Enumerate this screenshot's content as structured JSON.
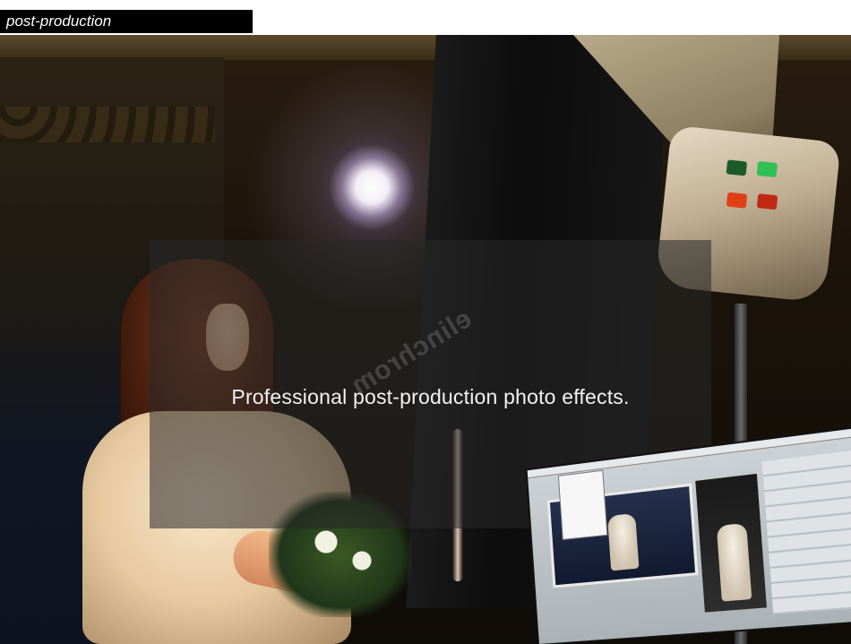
{
  "header": {
    "section_title": "post-production"
  },
  "hero": {
    "caption": "Professional post-production photo effects.",
    "softbox_brand": "elinchrom"
  },
  "colors": {
    "title_bar_bg": "#000000",
    "title_bar_text": "#ffffff",
    "overlay_bg": "rgba(40,40,40,0.55)",
    "caption_text": "#f2f2f2"
  },
  "images": {
    "background_photo": "bride-in-studio-with-lights",
    "inset_thumbnail": "photo-editing-software-screenshot"
  }
}
